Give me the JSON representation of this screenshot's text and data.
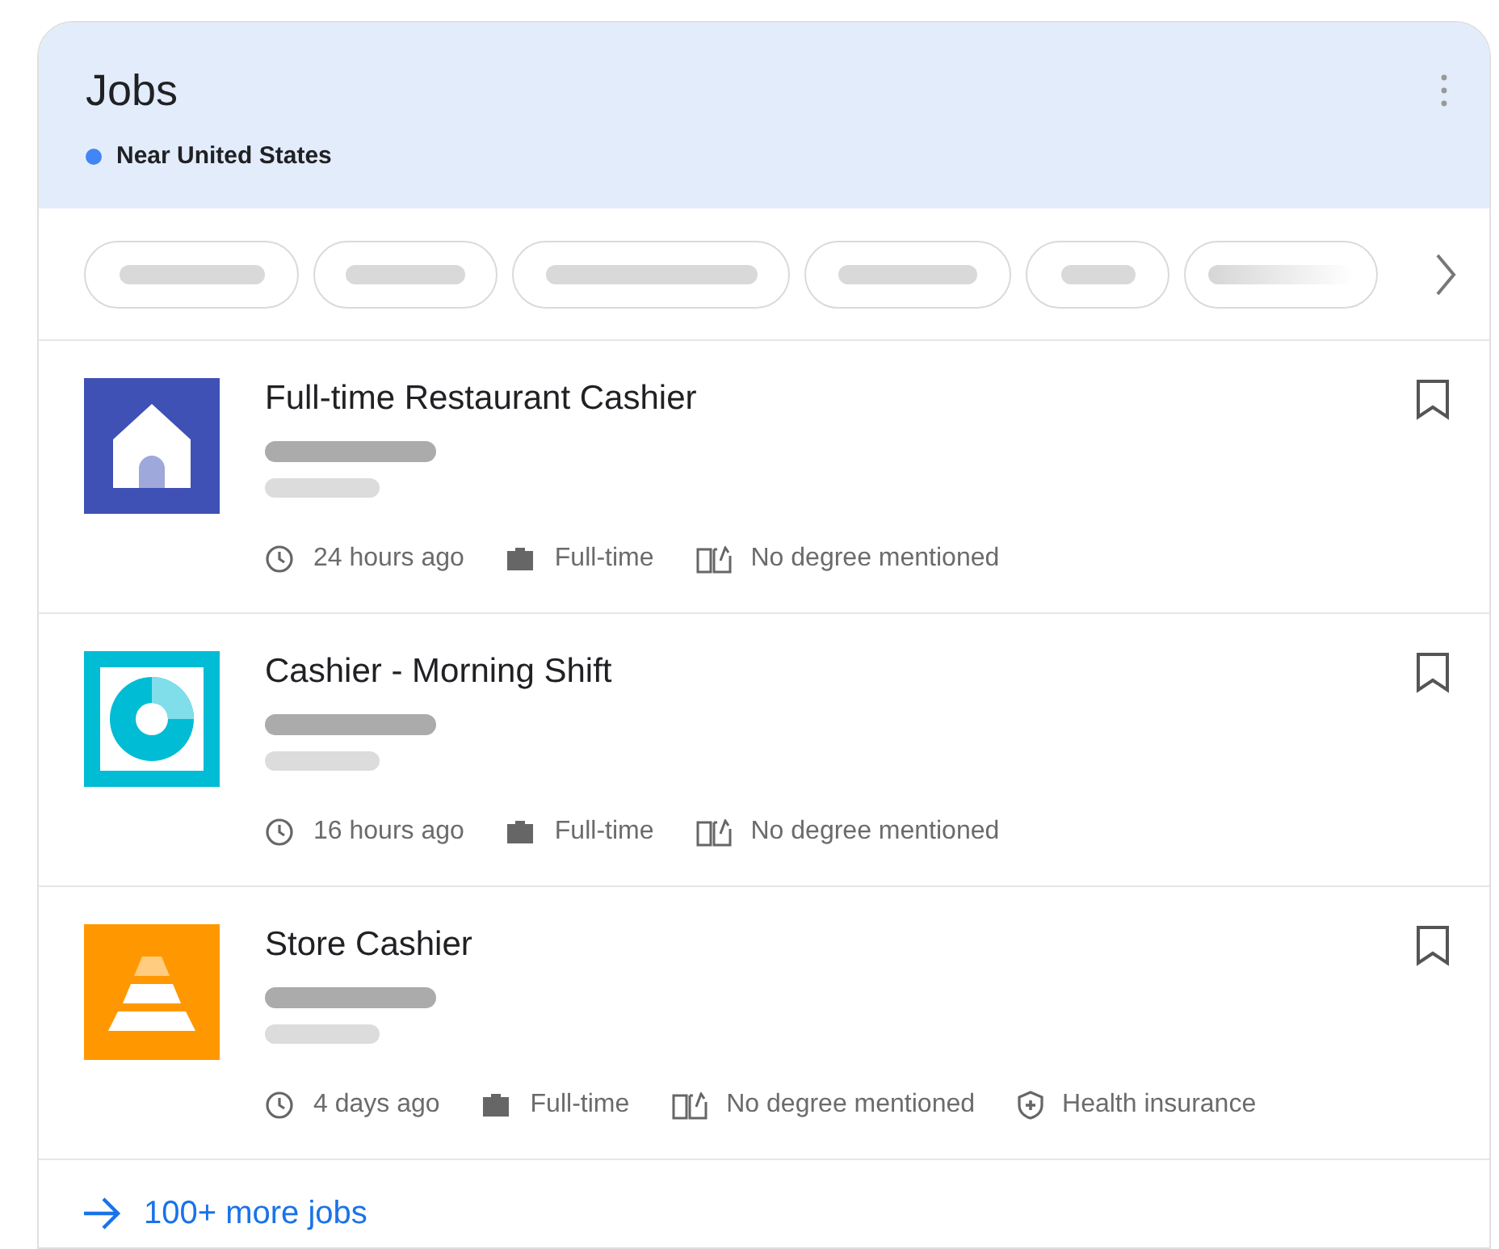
{
  "header": {
    "title": "Jobs",
    "location": {
      "text": "Near United States",
      "color": "#4285f4"
    }
  },
  "jobs": [
    {
      "title": "Full-time Restaurant Cashier",
      "logo": {
        "kind": "house",
        "color": "#3f51b5"
      },
      "saved": false,
      "meta": [
        {
          "kind": "clock",
          "text": "24 hours ago"
        },
        {
          "kind": "briefcase",
          "text": "Full-time"
        },
        {
          "kind": "degree",
          "text": "No degree mentioned"
        }
      ]
    },
    {
      "title": "Cashier - Morning Shift",
      "logo": {
        "kind": "ring",
        "color": "#00bcd4"
      },
      "saved": false,
      "meta": [
        {
          "kind": "clock",
          "text": "16 hours ago"
        },
        {
          "kind": "briefcase",
          "text": "Full-time"
        },
        {
          "kind": "degree",
          "text": "No degree mentioned"
        }
      ]
    },
    {
      "title": "Store Cashier",
      "logo": {
        "kind": "pyramid",
        "color": "#ff9800"
      },
      "saved": false,
      "meta": [
        {
          "kind": "clock",
          "text": "4 days ago"
        },
        {
          "kind": "briefcase",
          "text": "Full-time"
        },
        {
          "kind": "degree",
          "text": "No degree mentioned"
        },
        {
          "kind": "shield",
          "text": "Health insurance"
        }
      ]
    }
  ],
  "more_link": "100+ more jobs"
}
